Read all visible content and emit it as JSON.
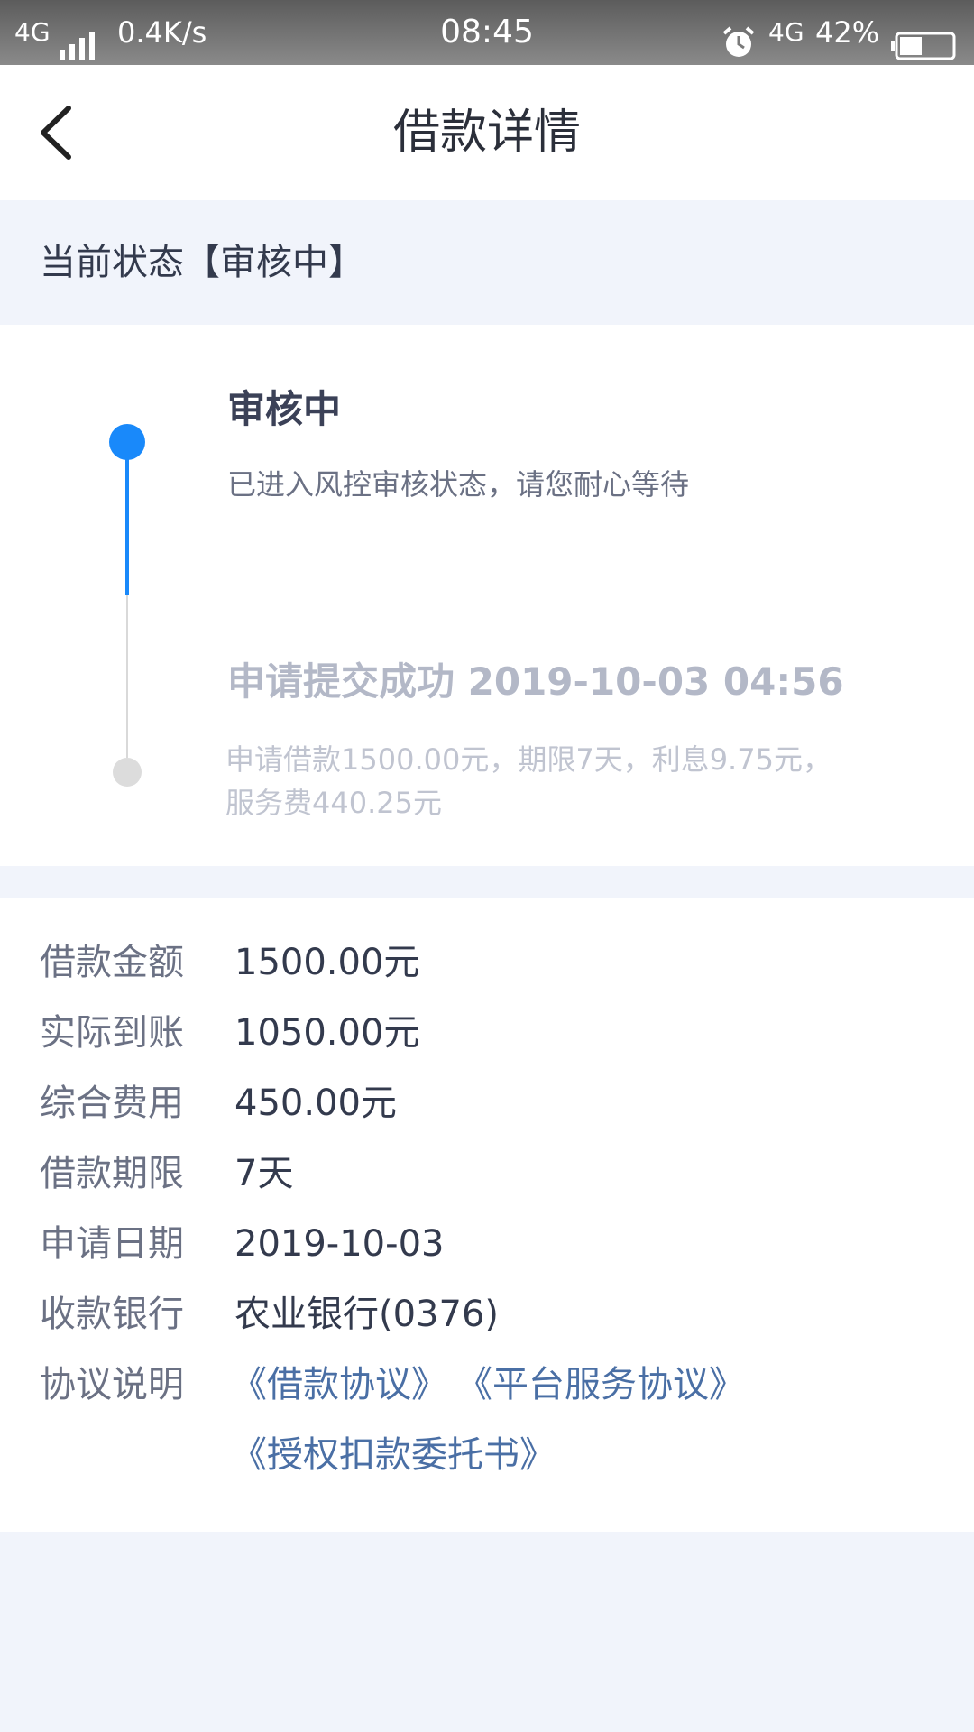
{
  "status_bar": {
    "network": "4G",
    "speed": "0.4K/s",
    "time": "08:45",
    "network2": "4G",
    "battery": "42%",
    "icons": [
      "signal-icon",
      "alarm-icon",
      "battery-icon"
    ]
  },
  "header": {
    "title": "借款详情",
    "back_icon": "chevron-left-icon"
  },
  "current_status": {
    "text": "当前状态【审核中】"
  },
  "timeline": {
    "items": [
      {
        "title": "审核中",
        "desc": "已进入风控审核状态，请您耐心等待"
      },
      {
        "title": "申请提交成功 2019-10-03 04:56",
        "desc": "申请借款1500.00元，期限7天，利息9.75元，服务费440.25元"
      }
    ]
  },
  "details": {
    "rows": [
      {
        "label": "借款金额",
        "value": "1500.00元"
      },
      {
        "label": "实际到账",
        "value": "1050.00元"
      },
      {
        "label": "综合费用",
        "value": "450.00元"
      },
      {
        "label": "借款期限",
        "value": "7天"
      },
      {
        "label": "申请日期",
        "value": "2019-10-03"
      },
      {
        "label": "收款银行",
        "value": "农业银行(0376)"
      }
    ],
    "agreement_label": "协议说明",
    "agreements": [
      "《借款协议》",
      "《平台服务协议》",
      "《授权扣款委托书》"
    ]
  },
  "colors": {
    "accent": "#1989fa",
    "link": "#4a6fa5",
    "background": "#f1f4fb"
  }
}
